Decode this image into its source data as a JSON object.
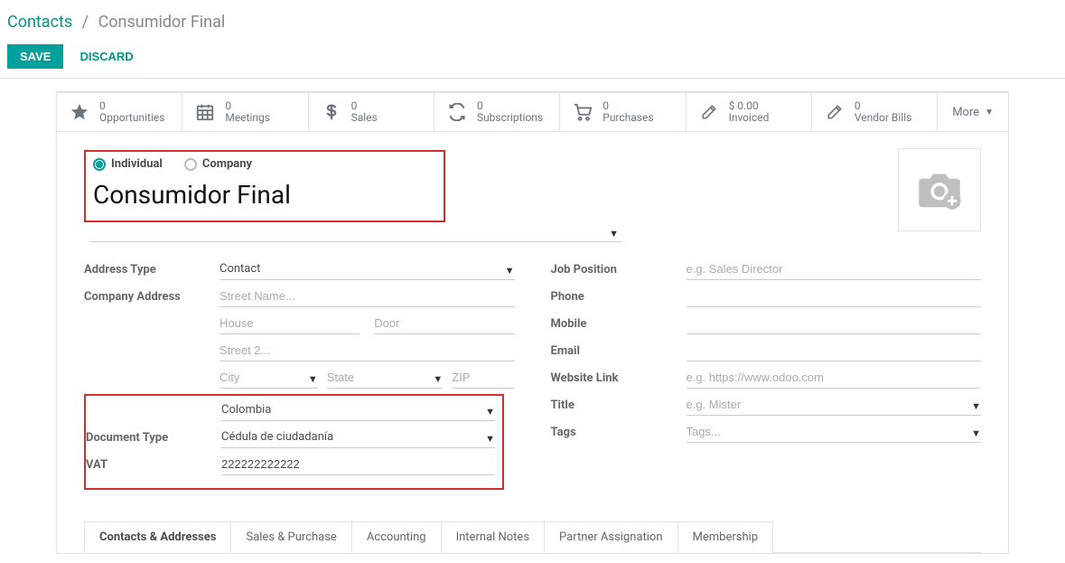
{
  "breadcrumb": {
    "root_label": "Contacts",
    "current_label": "Consumidor Final"
  },
  "actions": {
    "save_label": "SAVE",
    "discard_label": "DISCARD"
  },
  "stats": {
    "opportunities": {
      "value": "0",
      "label": "Opportunities"
    },
    "meetings": {
      "value": "0",
      "label": "Meetings"
    },
    "sales": {
      "value": "0",
      "label": "Sales"
    },
    "subscriptions": {
      "value": "0",
      "label": "Subscriptions"
    },
    "purchases": {
      "value": "0",
      "label": "Purchases"
    },
    "invoiced": {
      "value": "$ 0.00",
      "label": "Invoiced"
    },
    "vendor_bills": {
      "value": "0",
      "label": "Vendor Bills"
    },
    "more_label": "More"
  },
  "contact_type": {
    "individual_label": "Individual",
    "company_label": "Company",
    "selected": "individual"
  },
  "name": "Consumidor Final",
  "left_fields": {
    "address_type_label": "Address Type",
    "address_type_value": "Contact",
    "company_address_label": "Company Address",
    "street_placeholder": "Street Name...",
    "house_placeholder": "House",
    "door_placeholder": "Door",
    "street2_placeholder": "Street 2...",
    "city_placeholder": "City",
    "state_placeholder": "State",
    "zip_placeholder": "ZIP",
    "country_value": "Colombia",
    "document_type_label": "Document Type",
    "document_type_value": "Cédula de ciudadanía",
    "vat_label": "VAT",
    "vat_value": "222222222222"
  },
  "right_fields": {
    "job_position_label": "Job Position",
    "job_position_placeholder": "e.g. Sales Director",
    "phone_label": "Phone",
    "mobile_label": "Mobile",
    "email_label": "Email",
    "website_label": "Website Link",
    "website_placeholder": "e.g. https://www.odoo.com",
    "title_label": "Title",
    "title_placeholder": "e.g. Mister",
    "tags_label": "Tags",
    "tags_placeholder": "Tags..."
  },
  "tabs": {
    "items": [
      {
        "label": "Contacts & Addresses",
        "active": true
      },
      {
        "label": "Sales & Purchase",
        "active": false
      },
      {
        "label": "Accounting",
        "active": false
      },
      {
        "label": "Internal Notes",
        "active": false
      },
      {
        "label": "Partner Assignation",
        "active": false
      },
      {
        "label": "Membership",
        "active": false
      }
    ]
  }
}
